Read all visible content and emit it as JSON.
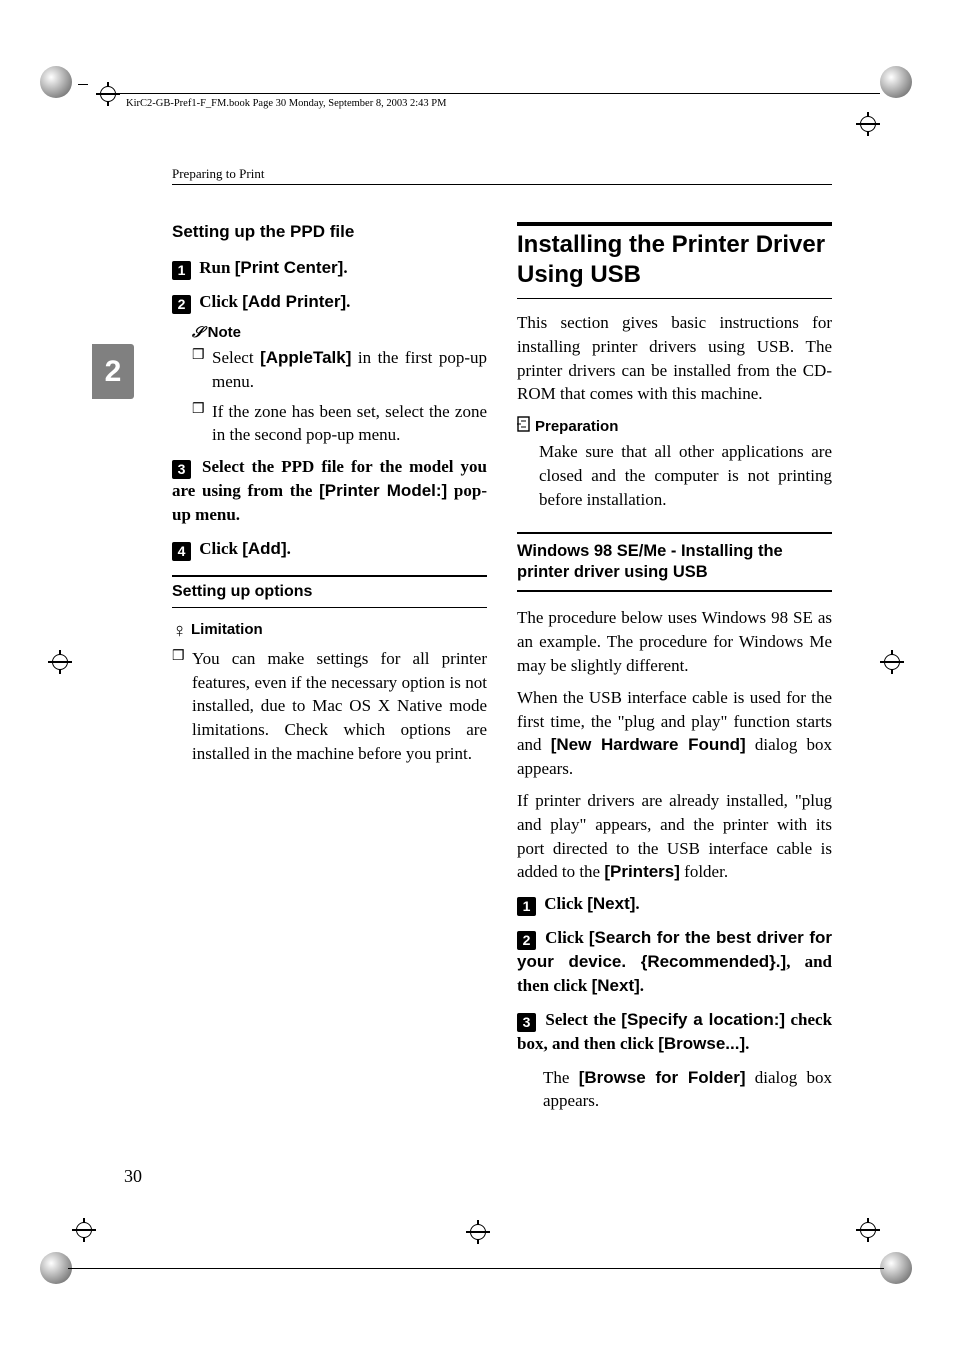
{
  "crop_header": "KirC2-GB-Pref1-F_FM.book  Page 30  Monday, September 8, 2003  2:43 PM",
  "running_head": "Preparing to Print",
  "side_tab": "2",
  "page_number": "30",
  "left": {
    "h_ppd": "Setting up the PPD file",
    "step1_verb": "Run ",
    "step1_ui": "[Print Center]",
    "step1_end": ".",
    "step2_verb": "Click ",
    "step2_ui": "[Add Printer]",
    "step2_end": ".",
    "note_label": "Note",
    "note_items": [
      {
        "pre": "Select ",
        "ui": "[AppleTalk]",
        "post": " in the first pop-up menu."
      },
      {
        "pre": "If the zone has been set, select the zone in the second pop-up menu.",
        "ui": "",
        "post": ""
      }
    ],
    "step3_pre": "Select the PPD file for the model you are using from the ",
    "step3_ui": "[Printer Model:]",
    "step3_post": " pop-up menu.",
    "step4_verb": "Click ",
    "step4_ui": "[Add]",
    "step4_end": ".",
    "h_options": "Setting up options",
    "lim_label": "Limitation",
    "lim_item": "You can make settings for all printer features, even if the necessary option is not installed, due to Mac OS X Native mode limitations. Check which options are installed in the machine before you print."
  },
  "right": {
    "h_main": "Installing the Printer Driver Using USB",
    "intro": "This section gives basic instructions for installing printer drivers using USB. The printer drivers can be installed from the CD-ROM that comes with this machine.",
    "prep_label": "Preparation",
    "prep_body": "Make sure that all other applications are closed and the computer is not printing before installation.",
    "subsect": "Windows 98 SE/Me - Installing the printer driver using USB",
    "p1": "The procedure below uses Windows 98 SE as an example. The procedure for Windows Me may be slightly different.",
    "p2_pre": "When the USB interface cable is used for the first time, the \"plug and play\" function starts and ",
    "p2_ui": "[New Hardware Found]",
    "p2_post": " dialog box appears.",
    "p3_pre": "If printer drivers are already installed, \"plug and play\" appears, and the printer with its port directed to the USB interface cable is added to the ",
    "p3_ui": "[Printers]",
    "p3_post": " folder.",
    "step1_verb": "Click ",
    "step1_ui": "[Next]",
    "step1_end": ".",
    "step2_verb": "Click ",
    "step2_ui": "[Search for the best driver for your device. {Recommended}.]",
    "step2_mid": ", and then click ",
    "step2_ui2": "[Next]",
    "step2_end": ".",
    "step3_pre": "Select the ",
    "step3_ui": "[Specify a location:]",
    "step3_mid": " check box, and then click ",
    "step3_ui2": "[Browse...]",
    "step3_end": ".",
    "step3_follow_pre": "The ",
    "step3_follow_ui": "[Browse for Folder]",
    "step3_follow_post": " dialog box appears."
  }
}
